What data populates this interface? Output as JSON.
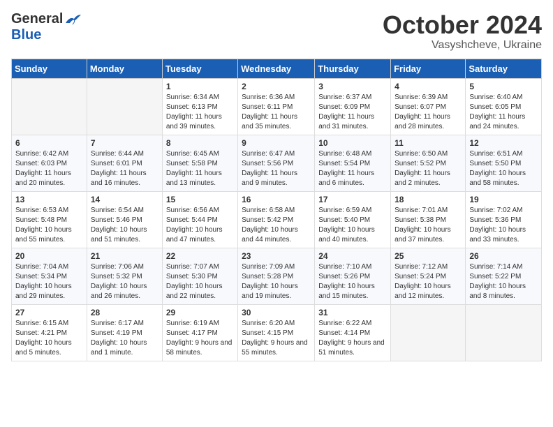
{
  "logo": {
    "general": "General",
    "blue": "Blue"
  },
  "title": {
    "month": "October 2024",
    "location": "Vasyshcheve, Ukraine"
  },
  "weekdays": [
    "Sunday",
    "Monday",
    "Tuesday",
    "Wednesday",
    "Thursday",
    "Friday",
    "Saturday"
  ],
  "weeks": [
    [
      {
        "day": "",
        "sunrise": "",
        "sunset": "",
        "daylight": ""
      },
      {
        "day": "",
        "sunrise": "",
        "sunset": "",
        "daylight": ""
      },
      {
        "day": "1",
        "sunrise": "Sunrise: 6:34 AM",
        "sunset": "Sunset: 6:13 PM",
        "daylight": "Daylight: 11 hours and 39 minutes."
      },
      {
        "day": "2",
        "sunrise": "Sunrise: 6:36 AM",
        "sunset": "Sunset: 6:11 PM",
        "daylight": "Daylight: 11 hours and 35 minutes."
      },
      {
        "day": "3",
        "sunrise": "Sunrise: 6:37 AM",
        "sunset": "Sunset: 6:09 PM",
        "daylight": "Daylight: 11 hours and 31 minutes."
      },
      {
        "day": "4",
        "sunrise": "Sunrise: 6:39 AM",
        "sunset": "Sunset: 6:07 PM",
        "daylight": "Daylight: 11 hours and 28 minutes."
      },
      {
        "day": "5",
        "sunrise": "Sunrise: 6:40 AM",
        "sunset": "Sunset: 6:05 PM",
        "daylight": "Daylight: 11 hours and 24 minutes."
      }
    ],
    [
      {
        "day": "6",
        "sunrise": "Sunrise: 6:42 AM",
        "sunset": "Sunset: 6:03 PM",
        "daylight": "Daylight: 11 hours and 20 minutes."
      },
      {
        "day": "7",
        "sunrise": "Sunrise: 6:44 AM",
        "sunset": "Sunset: 6:01 PM",
        "daylight": "Daylight: 11 hours and 16 minutes."
      },
      {
        "day": "8",
        "sunrise": "Sunrise: 6:45 AM",
        "sunset": "Sunset: 5:58 PM",
        "daylight": "Daylight: 11 hours and 13 minutes."
      },
      {
        "day": "9",
        "sunrise": "Sunrise: 6:47 AM",
        "sunset": "Sunset: 5:56 PM",
        "daylight": "Daylight: 11 hours and 9 minutes."
      },
      {
        "day": "10",
        "sunrise": "Sunrise: 6:48 AM",
        "sunset": "Sunset: 5:54 PM",
        "daylight": "Daylight: 11 hours and 6 minutes."
      },
      {
        "day": "11",
        "sunrise": "Sunrise: 6:50 AM",
        "sunset": "Sunset: 5:52 PM",
        "daylight": "Daylight: 11 hours and 2 minutes."
      },
      {
        "day": "12",
        "sunrise": "Sunrise: 6:51 AM",
        "sunset": "Sunset: 5:50 PM",
        "daylight": "Daylight: 10 hours and 58 minutes."
      }
    ],
    [
      {
        "day": "13",
        "sunrise": "Sunrise: 6:53 AM",
        "sunset": "Sunset: 5:48 PM",
        "daylight": "Daylight: 10 hours and 55 minutes."
      },
      {
        "day": "14",
        "sunrise": "Sunrise: 6:54 AM",
        "sunset": "Sunset: 5:46 PM",
        "daylight": "Daylight: 10 hours and 51 minutes."
      },
      {
        "day": "15",
        "sunrise": "Sunrise: 6:56 AM",
        "sunset": "Sunset: 5:44 PM",
        "daylight": "Daylight: 10 hours and 47 minutes."
      },
      {
        "day": "16",
        "sunrise": "Sunrise: 6:58 AM",
        "sunset": "Sunset: 5:42 PM",
        "daylight": "Daylight: 10 hours and 44 minutes."
      },
      {
        "day": "17",
        "sunrise": "Sunrise: 6:59 AM",
        "sunset": "Sunset: 5:40 PM",
        "daylight": "Daylight: 10 hours and 40 minutes."
      },
      {
        "day": "18",
        "sunrise": "Sunrise: 7:01 AM",
        "sunset": "Sunset: 5:38 PM",
        "daylight": "Daylight: 10 hours and 37 minutes."
      },
      {
        "day": "19",
        "sunrise": "Sunrise: 7:02 AM",
        "sunset": "Sunset: 5:36 PM",
        "daylight": "Daylight: 10 hours and 33 minutes."
      }
    ],
    [
      {
        "day": "20",
        "sunrise": "Sunrise: 7:04 AM",
        "sunset": "Sunset: 5:34 PM",
        "daylight": "Daylight: 10 hours and 29 minutes."
      },
      {
        "day": "21",
        "sunrise": "Sunrise: 7:06 AM",
        "sunset": "Sunset: 5:32 PM",
        "daylight": "Daylight: 10 hours and 26 minutes."
      },
      {
        "day": "22",
        "sunrise": "Sunrise: 7:07 AM",
        "sunset": "Sunset: 5:30 PM",
        "daylight": "Daylight: 10 hours and 22 minutes."
      },
      {
        "day": "23",
        "sunrise": "Sunrise: 7:09 AM",
        "sunset": "Sunset: 5:28 PM",
        "daylight": "Daylight: 10 hours and 19 minutes."
      },
      {
        "day": "24",
        "sunrise": "Sunrise: 7:10 AM",
        "sunset": "Sunset: 5:26 PM",
        "daylight": "Daylight: 10 hours and 15 minutes."
      },
      {
        "day": "25",
        "sunrise": "Sunrise: 7:12 AM",
        "sunset": "Sunset: 5:24 PM",
        "daylight": "Daylight: 10 hours and 12 minutes."
      },
      {
        "day": "26",
        "sunrise": "Sunrise: 7:14 AM",
        "sunset": "Sunset: 5:22 PM",
        "daylight": "Daylight: 10 hours and 8 minutes."
      }
    ],
    [
      {
        "day": "27",
        "sunrise": "Sunrise: 6:15 AM",
        "sunset": "Sunset: 4:21 PM",
        "daylight": "Daylight: 10 hours and 5 minutes."
      },
      {
        "day": "28",
        "sunrise": "Sunrise: 6:17 AM",
        "sunset": "Sunset: 4:19 PM",
        "daylight": "Daylight: 10 hours and 1 minute."
      },
      {
        "day": "29",
        "sunrise": "Sunrise: 6:19 AM",
        "sunset": "Sunset: 4:17 PM",
        "daylight": "Daylight: 9 hours and 58 minutes."
      },
      {
        "day": "30",
        "sunrise": "Sunrise: 6:20 AM",
        "sunset": "Sunset: 4:15 PM",
        "daylight": "Daylight: 9 hours and 55 minutes."
      },
      {
        "day": "31",
        "sunrise": "Sunrise: 6:22 AM",
        "sunset": "Sunset: 4:14 PM",
        "daylight": "Daylight: 9 hours and 51 minutes."
      },
      {
        "day": "",
        "sunrise": "",
        "sunset": "",
        "daylight": ""
      },
      {
        "day": "",
        "sunrise": "",
        "sunset": "",
        "daylight": ""
      }
    ]
  ]
}
